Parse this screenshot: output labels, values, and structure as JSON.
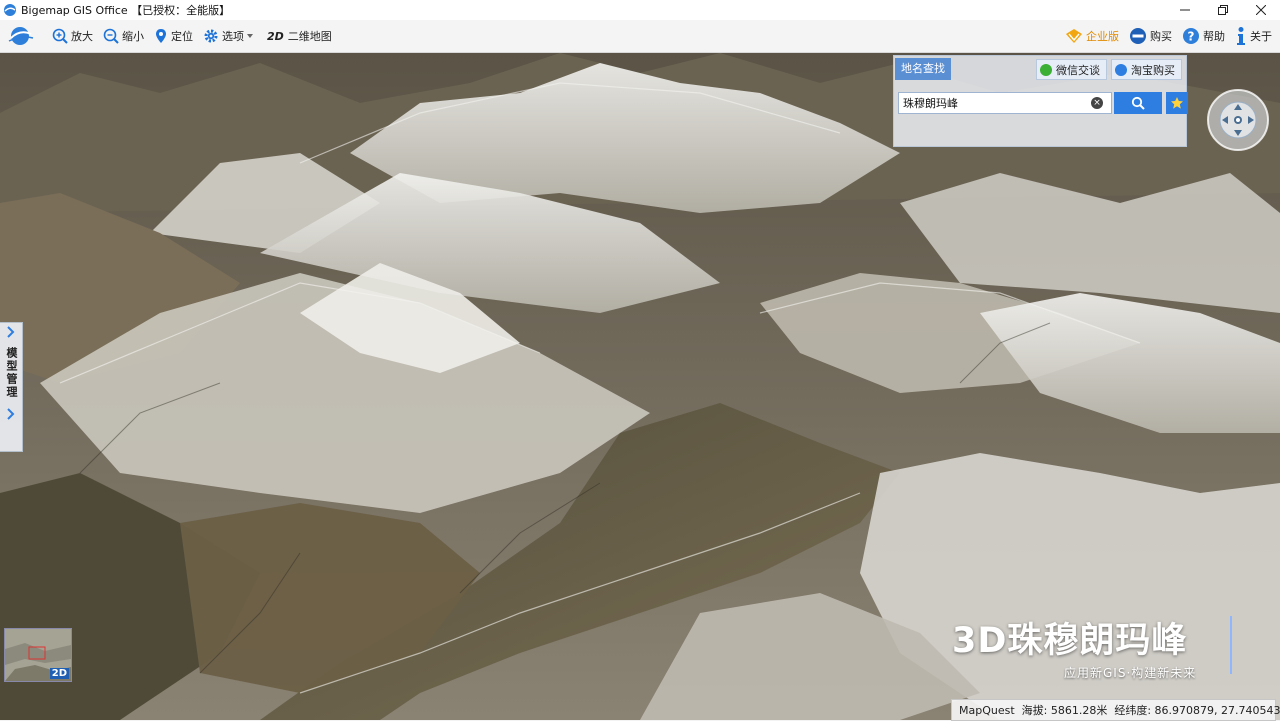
{
  "window": {
    "title": "Bigemap GIS Office 【已授权：全能版】"
  },
  "toolbar": {
    "zoom_in": "放大",
    "zoom_out": "缩小",
    "locate": "定位",
    "options": "选项",
    "mode_2d": "2D",
    "map_2d": "二维地图",
    "enterprise": "企业版",
    "buy": "购买",
    "help": "帮助",
    "about": "关于"
  },
  "search_panel": {
    "tab": "地名查找",
    "wechat": "微信交谈",
    "taobao": "淘宝购买",
    "query": "珠穆朗玛峰"
  },
  "side_tab": {
    "label": "模型管理"
  },
  "minimap": {
    "badge": "2D"
  },
  "branding": {
    "title": "3D珠穆朗玛峰",
    "subtitle": "应用新GIS·构建新未来"
  },
  "status": {
    "provider": "MapQuest",
    "elevation": "海拔: 5861.28米",
    "coords": "经纬度: 86.970879, 27.740543"
  },
  "colors": {
    "accent": "#2d7ee0",
    "enterprise": "#e08a00"
  }
}
